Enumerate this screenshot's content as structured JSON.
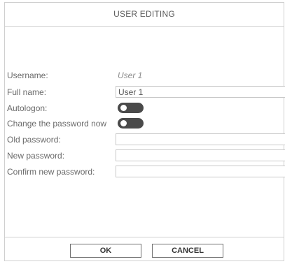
{
  "dialog": {
    "title": "USER EDITING"
  },
  "form": {
    "username_label": "Username:",
    "username_value": "User 1",
    "fullname_label": "Full name:",
    "fullname_value": "User 1",
    "autologon_label": "Autologon:",
    "autologon_on": false,
    "change_password_label": "Change the password now",
    "change_password_on": false,
    "old_password_label": "Old password:",
    "old_password_value": "",
    "new_password_label": "New password:",
    "new_password_value": "",
    "confirm_password_label": "Confirm new password:",
    "confirm_password_value": ""
  },
  "buttons": {
    "ok_label": "OK",
    "cancel_label": "CANCEL"
  },
  "colors": {
    "toggle_off": "#4a4a4a",
    "border": "#cfcfcf"
  }
}
